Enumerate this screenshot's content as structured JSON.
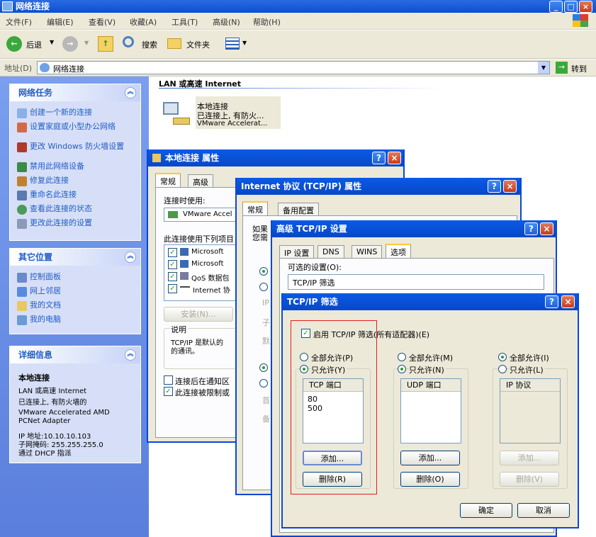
{
  "window": {
    "title": "网络连接"
  },
  "menu": [
    "文件(F)",
    "编辑(E)",
    "查看(V)",
    "收藏(A)",
    "工具(T)",
    "高级(N)",
    "帮助(H)"
  ],
  "toolbar": {
    "back": "后退",
    "search": "搜索",
    "folders": "文件夹"
  },
  "address": {
    "label": "地址(D)",
    "value": "网络连接",
    "go": "转到"
  },
  "sidebar": {
    "network_tasks": {
      "title": "网络任务",
      "items": [
        "创建一个新的连接",
        "设置家庭或小型办公网络",
        "更改 Windows 防火墙设置",
        "禁用此网络设备",
        "修复此连接",
        "重命名此连接",
        "查看此连接的状态",
        "更改此连接的设置"
      ]
    },
    "other_places": {
      "title": "其它位置",
      "items": [
        "控制面板",
        "网上邻居",
        "我的文档",
        "我的电脑"
      ]
    },
    "details": {
      "title": "详细信息",
      "name": "本地连接",
      "lines": [
        "LAN 或高速 Internet",
        "已连接上, 有防火墙的",
        "VMware Accelerated AMD",
        "PCNet Adapter",
        "IP 地址:10.10.10.103",
        "子网掩码: 255.255.255.0",
        "通过 DHCP 指派"
      ]
    }
  },
  "content": {
    "section": "LAN 或高速 Internet",
    "conn": {
      "name": "本地连接",
      "status": "已连接上, 有防火...",
      "device": "VMware Accelerat..."
    }
  },
  "dlg1": {
    "title": "本地连接 属性",
    "tabs": [
      "常规",
      "高级"
    ],
    "connect_using": "连接时使用:",
    "adapter": "VMware Accel",
    "uses_label": "此连接使用下列项目",
    "items": [
      "Microsoft",
      "Microsoft",
      "QoS 数据包",
      "Internet 协"
    ],
    "install": "安装(N)...",
    "desc_title": "说明",
    "desc": "TCP/IP 是默认的",
    "desc2": "的通讯。",
    "chk1": "连接后在通知区",
    "chk2": "此连接被限制或"
  },
  "dlg2": {
    "title": "Internet 协议 (TCP/IP) 属性",
    "tabs": [
      "常规",
      "备用配置"
    ],
    "t1": "如果",
    "t2": "您需",
    "s1": "IP",
    "s2": "子",
    "s3": "默",
    "s4": "首",
    "s5": "备"
  },
  "dlg3": {
    "title": "高级 TCP/IP 设置",
    "tabs": [
      "IP 设置",
      "DNS",
      "WINS",
      "选项"
    ],
    "opt_label": "可选的设置(O):",
    "opt_item": "TCP/IP 筛选"
  },
  "dlg4": {
    "title": "TCP/IP 筛选",
    "enable": "启用 TCP/IP 筛选(所有适配器)(E)",
    "tcp": {
      "allow_all": "全部允许(P)",
      "allow_only": "只允许(Y)",
      "header": "TCP 端口",
      "ports": [
        "80",
        "500"
      ],
      "add": "添加...",
      "remove": "删除(R)"
    },
    "udp": {
      "allow_all": "全部允许(M)",
      "allow_only": "只允许(N)",
      "header": "UDP 端口",
      "add": "添加...",
      "remove": "删除(O)"
    },
    "ip": {
      "allow_all": "全部允许(I)",
      "allow_only": "只允许(L)",
      "header": "IP 协议",
      "add": "添加...",
      "remove": "删除(V)"
    },
    "ok": "确定",
    "cancel": "取消"
  }
}
